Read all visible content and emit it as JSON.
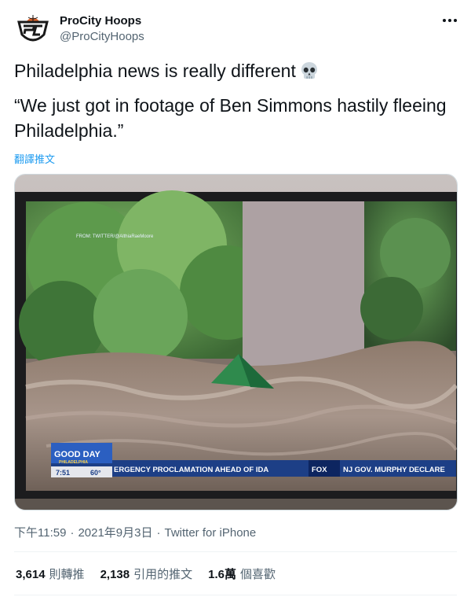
{
  "author": {
    "name": "ProCity Hoops",
    "handle": "@ProCityHoops"
  },
  "tweet": {
    "line1": "Philadelphia news is really different",
    "line2": "“We just got in footage of Ben Simmons hastily fleeing Philadelphia.”",
    "translate_label": "翻譯推文"
  },
  "media": {
    "watermark": "FROM: TWITTER/@AlthiaRaeMoore",
    "logo_top": "GOOD DAY",
    "logo_bottom": "PHILADELPHIA",
    "time": "7:51",
    "temperature": "60°",
    "ticker": "ERGENCY PROCLAMATION AHEAD OF IDA",
    "network": "FOX",
    "ticker_right": "NJ GOV. MURPHY DECLARE"
  },
  "meta": {
    "time": "下午11:59",
    "date": "2021年9月3日",
    "separator": "·",
    "source": "Twitter for iPhone"
  },
  "stats": {
    "retweets_value": "3,614",
    "retweets_label": "則轉推",
    "quotes_value": "2,138",
    "quotes_label": "引用的推文",
    "likes_value": "1.6萬",
    "likes_label": "個喜歡"
  },
  "colors": {
    "link": "#1d9bf0",
    "secondary_text": "#536471",
    "primary_text": "#0f1419"
  },
  "icons": {
    "avatar": "procity-logo",
    "more": "more-horizontal-icon",
    "emoji": "skull-icon"
  }
}
